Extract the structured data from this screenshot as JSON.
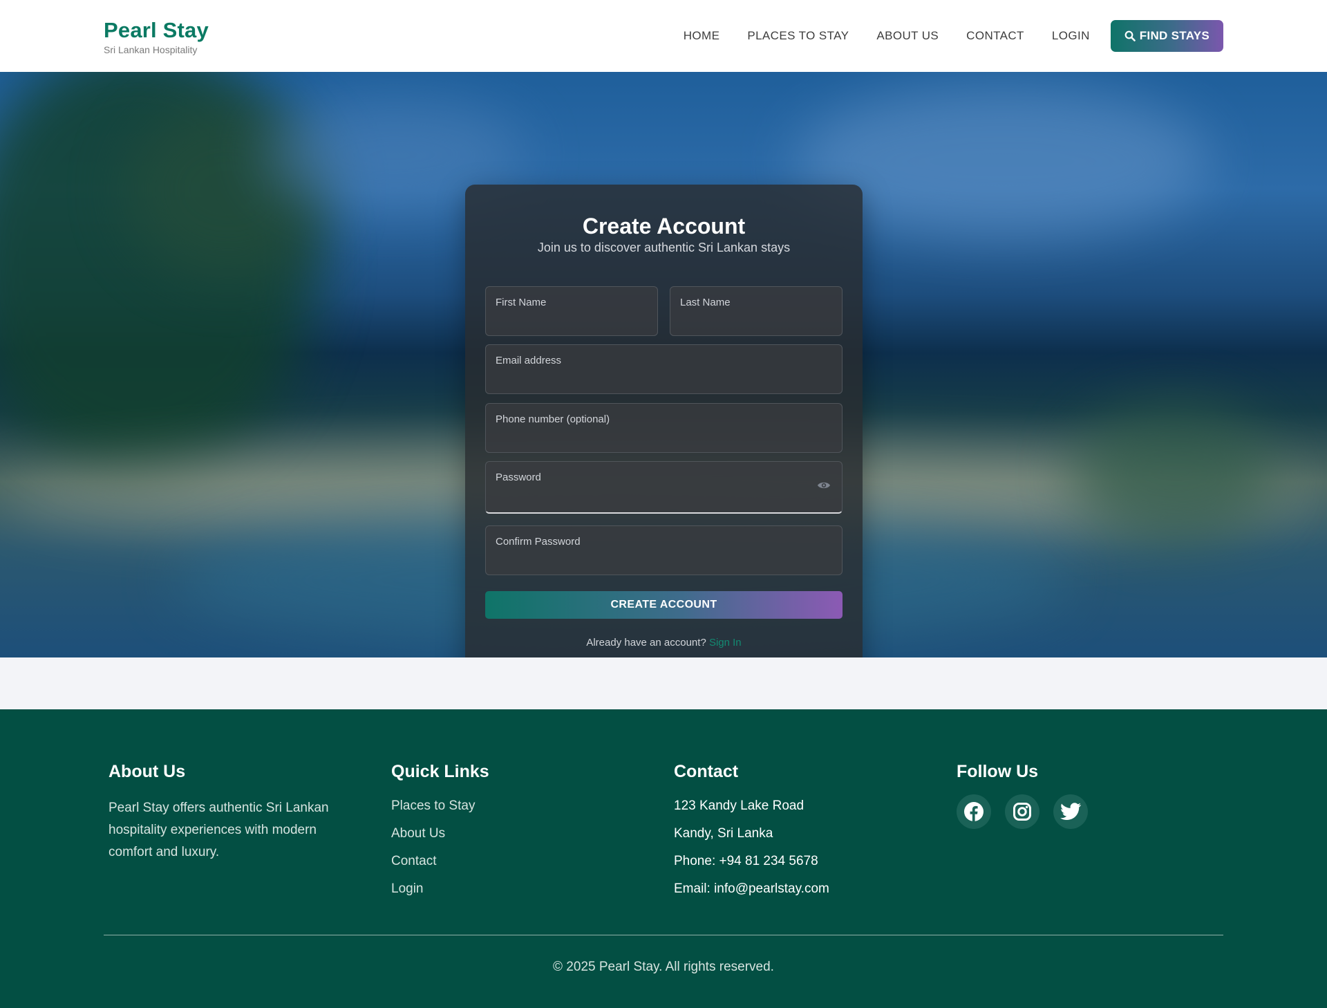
{
  "brand": {
    "title": "Pearl Stay",
    "subtitle": "Sri Lankan Hospitality",
    "color": "#0b7a63"
  },
  "nav": {
    "items": [
      {
        "label": "HOME"
      },
      {
        "label": "PLACES TO STAY"
      },
      {
        "label": "ABOUT US"
      },
      {
        "label": "CONTACT"
      },
      {
        "label": "LOGIN"
      }
    ],
    "cta_label": "FIND STAYS",
    "cta_icon": "search-icon"
  },
  "form": {
    "title": "Create Account",
    "subtitle": "Join us to discover authentic Sri Lankan stays",
    "fields": {
      "first_name": {
        "label": "First Name",
        "value": ""
      },
      "last_name": {
        "label": "Last Name",
        "value": ""
      },
      "email": {
        "label": "Email address",
        "value": ""
      },
      "phone": {
        "label": "Phone number (optional)",
        "value": ""
      },
      "password": {
        "label": "Password",
        "value": "",
        "icon": "eye-icon"
      },
      "confirm_password": {
        "label": "Confirm Password",
        "value": ""
      }
    },
    "submit_label": "CREATE ACCOUNT",
    "signin_prompt": "Already have an account?",
    "signin_link": "Sign In"
  },
  "footer": {
    "about": {
      "heading": "About Us",
      "text": "Pearl Stay offers authentic Sri Lankan hospitality experiences with modern comfort and luxury."
    },
    "quick_links": {
      "heading": "Quick Links",
      "items": [
        "Places to Stay",
        "About Us",
        "Contact",
        "Login"
      ]
    },
    "contact": {
      "heading": "Contact",
      "lines": [
        "123 Kandy Lake Road",
        "Kandy, Sri Lanka",
        "Phone: +94 81 234 5678",
        "Email: info@pearlstay.com"
      ]
    },
    "follow": {
      "heading": "Follow Us",
      "icons": [
        "facebook-icon",
        "instagram-icon",
        "twitter-icon"
      ]
    },
    "copyright": "© 2025 Pearl Stay. All rights reserved.",
    "background": "#034f43"
  }
}
